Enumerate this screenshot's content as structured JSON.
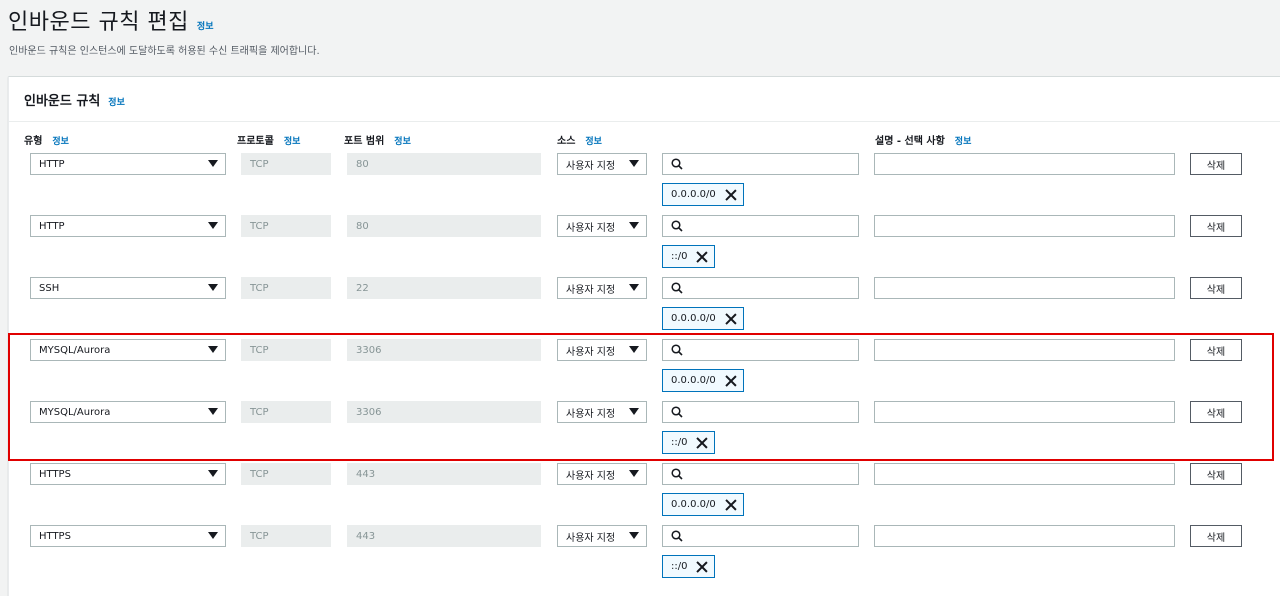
{
  "page": {
    "title": "인바운드 규칙 편집",
    "info": "정보",
    "description": "인바운드 규칙은 인스턴스에 도달하도록 허용된 수신 트래픽을 제어합니다."
  },
  "panel": {
    "title": "인바운드 규칙",
    "info": "정보"
  },
  "columns": {
    "type": "유형",
    "protocol": "프로토콜",
    "port_range": "포트 범위",
    "source": "소스",
    "description": "설명 - 선택 사항",
    "info": "정보"
  },
  "rules": [
    {
      "type": "HTTP",
      "protocol": "TCP",
      "port": "80",
      "source": "사용자 지정",
      "cidr": "0.0.0.0/0",
      "delete": "삭제"
    },
    {
      "type": "HTTP",
      "protocol": "TCP",
      "port": "80",
      "source": "사용자 지정",
      "cidr": "::/0",
      "delete": "삭제"
    },
    {
      "type": "SSH",
      "protocol": "TCP",
      "port": "22",
      "source": "사용자 지정",
      "cidr": "0.0.0.0/0",
      "delete": "삭제"
    },
    {
      "type": "MYSQL/Aurora",
      "protocol": "TCP",
      "port": "3306",
      "source": "사용자 지정",
      "cidr": "0.0.0.0/0",
      "delete": "삭제"
    },
    {
      "type": "MYSQL/Aurora",
      "protocol": "TCP",
      "port": "3306",
      "source": "사용자 지정",
      "cidr": "::/0",
      "delete": "삭제"
    },
    {
      "type": "HTTPS",
      "protocol": "TCP",
      "port": "443",
      "source": "사용자 지정",
      "cidr": "0.0.0.0/0",
      "delete": "삭제"
    },
    {
      "type": "HTTPS",
      "protocol": "TCP",
      "port": "443",
      "source": "사용자 지정",
      "cidr": "::/0",
      "delete": "삭제"
    }
  ],
  "icons": {
    "search": "search-icon",
    "caret": "caret-down-icon",
    "remove": "close-icon"
  },
  "colors": {
    "link": "#0073bb",
    "highlight": "#e00000",
    "token_border": "#0073bb"
  }
}
